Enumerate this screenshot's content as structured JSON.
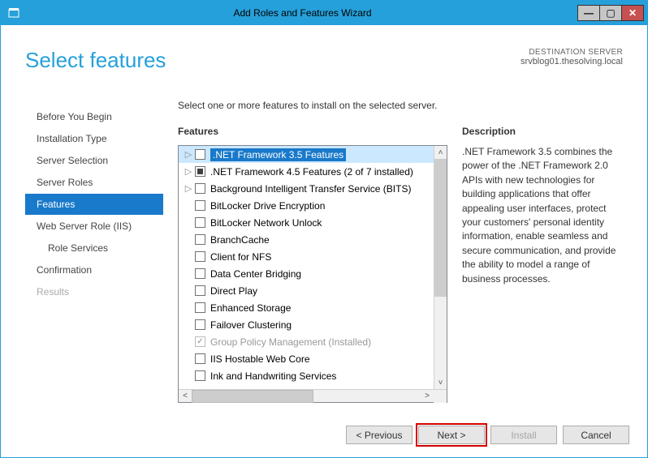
{
  "window": {
    "title": "Add Roles and Features Wizard"
  },
  "page_title": "Select features",
  "destination": {
    "label": "DESTINATION SERVER",
    "server": "srvblog01.thesolving.local"
  },
  "instruction": "Select one or more features to install on the selected server.",
  "sidebar": {
    "items": [
      {
        "label": "Before You Begin"
      },
      {
        "label": "Installation Type"
      },
      {
        "label": "Server Selection"
      },
      {
        "label": "Server Roles"
      },
      {
        "label": "Features",
        "selected": true
      },
      {
        "label": "Web Server Role (IIS)"
      },
      {
        "label": "Role Services",
        "sub": true
      },
      {
        "label": "Confirmation"
      },
      {
        "label": "Results",
        "disabled": true
      }
    ]
  },
  "features": {
    "heading": "Features",
    "items": [
      {
        "label": ".NET Framework 3.5 Features",
        "expandable": true,
        "selected": true
      },
      {
        "label": ".NET Framework 4.5 Features (2 of 7 installed)",
        "expandable": true,
        "partial": true
      },
      {
        "label": "Background Intelligent Transfer Service (BITS)",
        "expandable": true
      },
      {
        "label": "BitLocker Drive Encryption"
      },
      {
        "label": "BitLocker Network Unlock"
      },
      {
        "label": "BranchCache"
      },
      {
        "label": "Client for NFS"
      },
      {
        "label": "Data Center Bridging"
      },
      {
        "label": "Direct Play"
      },
      {
        "label": "Enhanced Storage"
      },
      {
        "label": "Failover Clustering"
      },
      {
        "label": "Group Policy Management (Installed)",
        "installed": true,
        "checked": true
      },
      {
        "label": "IIS Hostable Web Core"
      },
      {
        "label": "Ink and Handwriting Services"
      }
    ]
  },
  "description": {
    "heading": "Description",
    "text": ".NET Framework 3.5 combines the power of the .NET Framework 2.0 APIs with new technologies for building applications that offer appealing user interfaces, protect your customers' personal identity information, enable seamless and secure communication, and provide the ability to model a range of business processes."
  },
  "footer": {
    "previous": "< Previous",
    "next": "Next >",
    "install": "Install",
    "cancel": "Cancel"
  }
}
